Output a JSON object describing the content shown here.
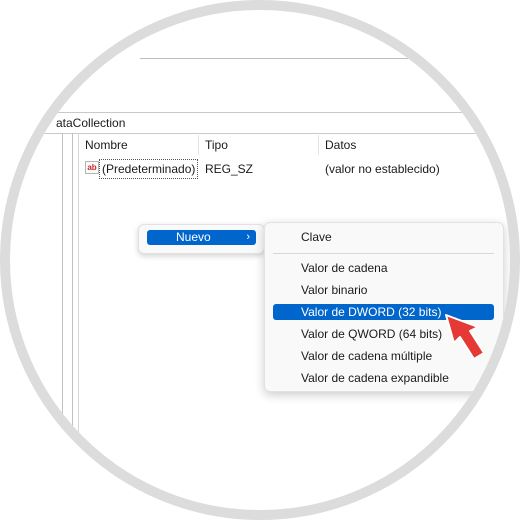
{
  "address": {
    "text": "ataCollection"
  },
  "columns": {
    "name": "Nombre",
    "type": "Tipo",
    "data": "Datos"
  },
  "row": {
    "icon_text": "ab",
    "name": "(Predeterminado)",
    "type": "REG_SZ",
    "data": "(valor no establecido)"
  },
  "context_menu": {
    "nuevo_label": "Nuevo",
    "arrow": "›"
  },
  "submenu": {
    "items": [
      "Clave",
      "Valor de cadena",
      "Valor binario",
      "Valor de DWORD (32 bits)",
      "Valor de QWORD (64 bits)",
      "Valor de cadena múltiple",
      "Valor de cadena expandible"
    ],
    "selected": "Valor de DWORD (32 bits)"
  },
  "colors": {
    "accent": "#0066cc",
    "cursor": "#e53935",
    "frame": "#dcdcdc"
  },
  "icons": {
    "cursor": "red-arrow-cursor-icon",
    "value": "string-value-icon"
  }
}
